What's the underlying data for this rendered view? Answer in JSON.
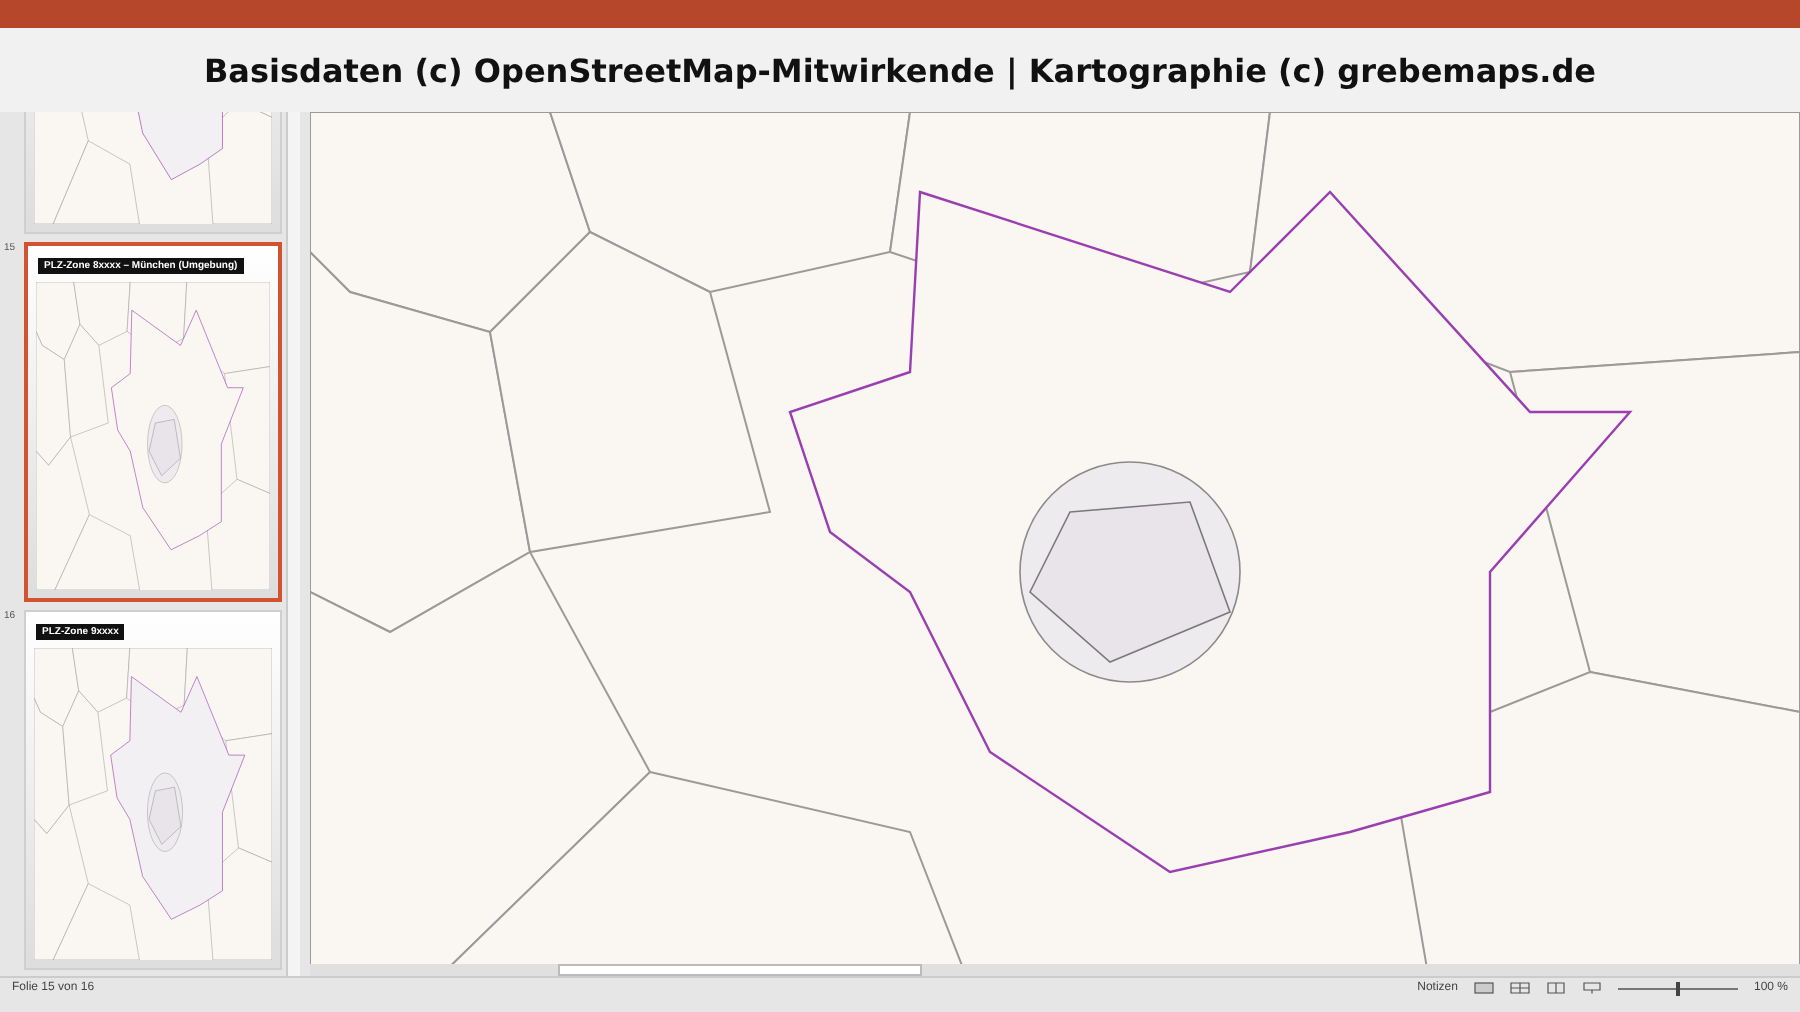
{
  "caption": "Basisdaten (c) OpenStreetMap-Mitwirkende | Kartographie (c) grebemaps.de",
  "thumbnails": [
    {
      "selected": false
    },
    {
      "number": "15",
      "title": "PLZ-Zone 8xxxx – München (Umgebung)",
      "selected": true
    },
    {
      "number": "16",
      "title": "PLZ-Zone 9xxxx",
      "selected": false
    }
  ],
  "status_bar": {
    "slide_info": "Folie 15 von 16",
    "notes": "Notizen",
    "zoom": {
      "level": 0.5,
      "reading": "100 %"
    }
  }
}
